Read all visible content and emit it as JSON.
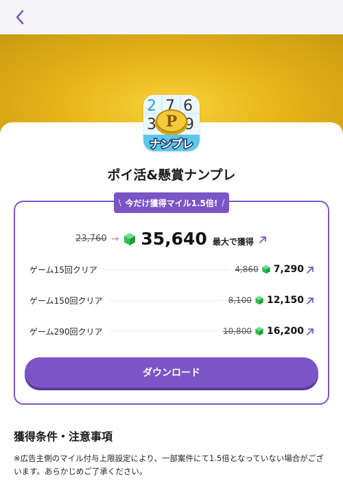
{
  "header": {
    "back_icon": "chevron-left-icon"
  },
  "app": {
    "title": "ポイ活&懸賞ナンプレ",
    "icon_name": "numberplace-app-icon"
  },
  "promo": {
    "tag_left": "\\",
    "tag_text": "今だけ獲得マイル1.5倍!",
    "tag_right": "/"
  },
  "reward": {
    "old_total": "23,760",
    "arrow": "→",
    "new_total": "35,640",
    "max_label": "最大で獲得",
    "currency_icon": "green-gem-icon",
    "external_icon": "arrow-up-right-icon"
  },
  "tiers": [
    {
      "label": "ゲーム15回クリア",
      "old": "4,860",
      "new": "7,290"
    },
    {
      "label": "ゲーム150回クリア",
      "old": "8,100",
      "new": "12,150"
    },
    {
      "label": "ゲーム290回クリア",
      "old": "10,800",
      "new": "16,200"
    }
  ],
  "download": {
    "label": "ダウンロード"
  },
  "conditions": {
    "title": "獲得条件・注意事項",
    "notice": "※広告主側のマイル付与上限設定により、一部案件にて1.5倍となっていない場合がございます。あらかじめご了承ください。"
  },
  "colors": {
    "accent": "#7b55c6",
    "accent_dark": "#5a3a9c",
    "gem": "#2fbf4a",
    "hero": "#e6b51a"
  }
}
